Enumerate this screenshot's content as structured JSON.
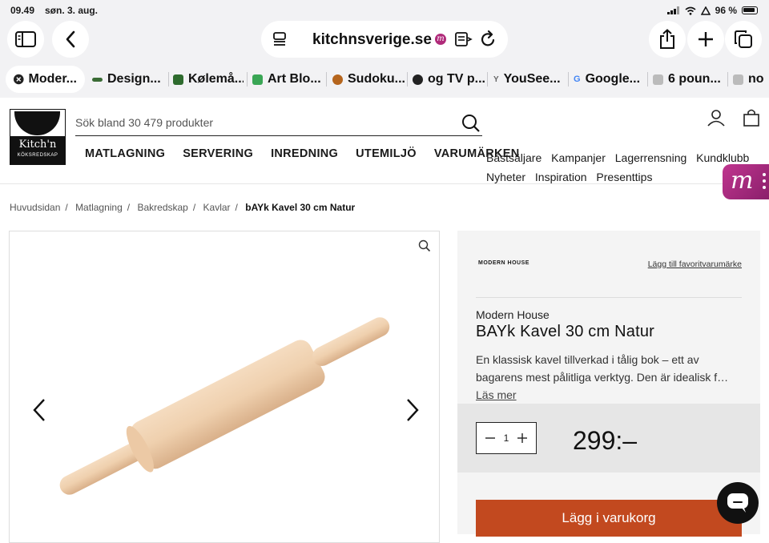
{
  "status_bar": {
    "time": "09.49",
    "date": "søn. 3. aug.",
    "battery": "96 %"
  },
  "browser": {
    "url": "kitchnsverige.se",
    "tabs": [
      {
        "label": "Moder...",
        "icon": "close-icon",
        "color": "#222222"
      },
      {
        "label": "Design...",
        "icon": "design-favicon",
        "color": "#3a6b35"
      },
      {
        "label": "Kølemå...",
        "icon": "kolema-favicon",
        "color": "#2e6b2e"
      },
      {
        "label": "Art Blo...",
        "icon": "art-favicon",
        "color": "#3aa655"
      },
      {
        "label": "Sudoku...",
        "icon": "sudoku-favicon",
        "color": "#b5651d"
      },
      {
        "label": "og TV p...",
        "icon": "tv-favicon",
        "color": "#222222"
      },
      {
        "label": "YouSee...",
        "icon": "yousee-favicon",
        "color": "#888888"
      },
      {
        "label": "Google...",
        "icon": "google-favicon",
        "color": "#4285f4"
      },
      {
        "label": "6 poun...",
        "icon": "generic-favicon",
        "color": "#999999"
      },
      {
        "label": "no",
        "icon": "generic-favicon",
        "color": "#999999"
      }
    ]
  },
  "site": {
    "logo": {
      "name": "Kitch'n",
      "sub": "KÖKSREDSKAP"
    },
    "search_placeholder": "Sök bland 30 479 produkter",
    "main_nav": [
      "MATLAGNING",
      "SERVERING",
      "INREDNING",
      "UTEMILJÖ",
      "VARUMÄRKEN"
    ],
    "secondary_nav": [
      "Bästsäljare",
      "Kampanjer",
      "Lagerrensning",
      "Kundklubb",
      "Nyheter",
      "Inspiration",
      "Presenttips"
    ]
  },
  "breadcrumb": [
    "Huvudsidan",
    "Matlagning",
    "Bakredskap",
    "Kavlar"
  ],
  "breadcrumb_current": "bAYk Kavel 30 cm Natur",
  "product": {
    "brand_logo": "MODERN HOUSE",
    "favorite_link": "Lägg till favoritvarumärke",
    "brand": "Modern House",
    "title": "BAYk Kavel 30 cm Natur",
    "description": "En klassisk kavel tillverkad i tålig bok – ett av bagarens mest pålitliga verktyg. Den är idealisk f…",
    "read_more": "Läs mer",
    "quantity": "1",
    "price": "299:–",
    "add_to_cart": "Lägg i varukorg"
  },
  "colors": {
    "accent": "#c2491f",
    "badge": "#b02a7a"
  }
}
